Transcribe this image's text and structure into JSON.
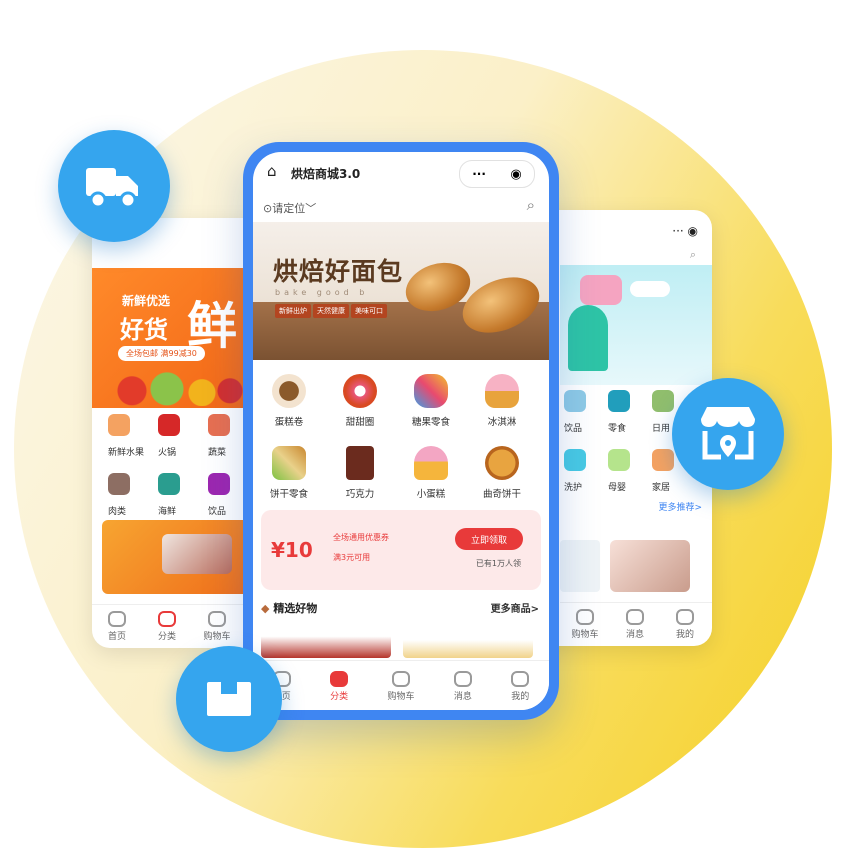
{
  "colors": {
    "accent": "#3f86f2",
    "bubble": "#35a5ee",
    "coupon_red": "#e83a3a",
    "backdrop": "#f5cf22"
  },
  "main_phone": {
    "app_title": "烘焙商城3.0",
    "location": "请定位",
    "hero": {
      "title": "烘焙好面包",
      "subtitle": "bake good b",
      "tags": [
        "新鲜出炉",
        "天然健康",
        "美味可口"
      ]
    },
    "categories": [
      {
        "label": "蛋糕卷",
        "icon": "cake-icon"
      },
      {
        "label": "甜甜圈",
        "icon": "donut-icon"
      },
      {
        "label": "糖果零食",
        "icon": "candy-icon"
      },
      {
        "label": "冰淇淋",
        "icon": "ice-cream-icon"
      },
      {
        "label": "饼干零食",
        "icon": "cookie-icon"
      },
      {
        "label": "巧克力",
        "icon": "chocolate-icon"
      },
      {
        "label": "小蛋糕",
        "icon": "cupcake-icon"
      },
      {
        "label": "曲奇饼干",
        "icon": "biscuit-icon"
      }
    ],
    "coupon": {
      "value": "¥10",
      "desc": "全场通用优惠券",
      "sub": "满3元可用",
      "button": "立即领取",
      "note": "已有1万人领"
    },
    "section": {
      "title": "精选好物",
      "more": "更多商品>"
    },
    "tabs": [
      "首页",
      "分类",
      "购物车",
      "消息",
      "我的"
    ]
  },
  "left_phone": {
    "banner_line1": "新鲜优选",
    "banner_line2": "好货",
    "banner_big": "鲜",
    "banner_strip": "全场包邮 满99减30",
    "grid": [
      "新鲜水果",
      "火锅",
      "蔬菜",
      "肉类",
      "海鲜",
      "饮品"
    ],
    "tabs": [
      "首页",
      "分类",
      "购物车"
    ]
  },
  "right_phone": {
    "more": "更多推荐>",
    "grid": [
      "饮品",
      "零食",
      "日用",
      "洗护",
      "母婴",
      "家居"
    ],
    "tabs": [
      "购物车",
      "消息",
      "我的"
    ]
  }
}
